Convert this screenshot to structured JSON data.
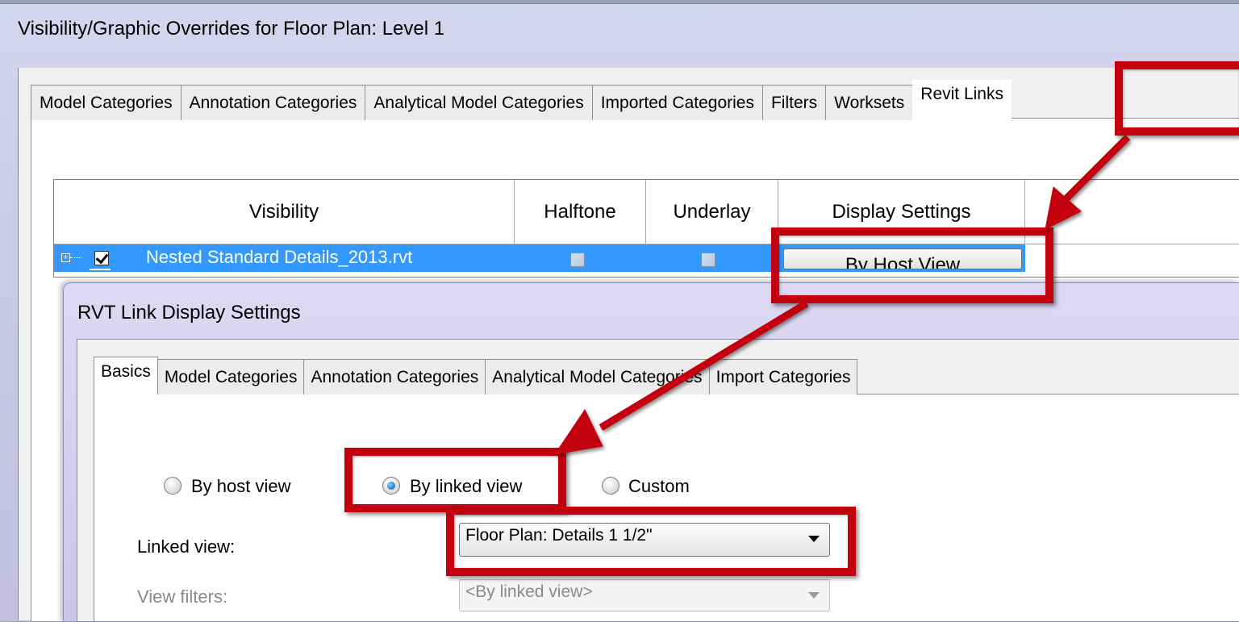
{
  "outer_dialog": {
    "title": "Visibility/Graphic Overrides for Floor Plan: Level 1",
    "tabs": [
      {
        "label": "Model Categories",
        "active": false
      },
      {
        "label": "Annotation Categories",
        "active": false
      },
      {
        "label": "Analytical Model Categories",
        "active": false
      },
      {
        "label": "Imported Categories",
        "active": false
      },
      {
        "label": "Filters",
        "active": false
      },
      {
        "label": "Worksets",
        "active": false
      },
      {
        "label": "Revit Links",
        "active": true
      }
    ]
  },
  "links_table": {
    "columns": [
      "Visibility",
      "Halftone",
      "Underlay",
      "Display Settings"
    ],
    "row": {
      "name": "Nested Standard Details_2013.rvt",
      "visible": true,
      "halftone": false,
      "underlay": false,
      "display_button": "By Host View"
    }
  },
  "inner_dialog": {
    "title": "RVT Link Display Settings",
    "tabs": [
      {
        "label": "Basics",
        "active": true
      },
      {
        "label": "Model Categories",
        "active": false
      },
      {
        "label": "Annotation Categories",
        "active": false
      },
      {
        "label": "Analytical Model Categories",
        "active": false
      },
      {
        "label": "Import Categories",
        "active": false
      }
    ],
    "radios": [
      {
        "label": "By host view",
        "selected": false
      },
      {
        "label": "By linked view",
        "selected": true
      },
      {
        "label": "Custom",
        "selected": false
      }
    ],
    "linked_view": {
      "label": "Linked view:",
      "value": "Floor Plan: Details 1 1/2\""
    },
    "view_filters": {
      "label": "View filters:",
      "value": "<By linked view>"
    }
  },
  "colors": {
    "callout_red": "#c3000e",
    "selection_blue": "#3399ff",
    "dialog_lavender": "#cbc6ea"
  }
}
